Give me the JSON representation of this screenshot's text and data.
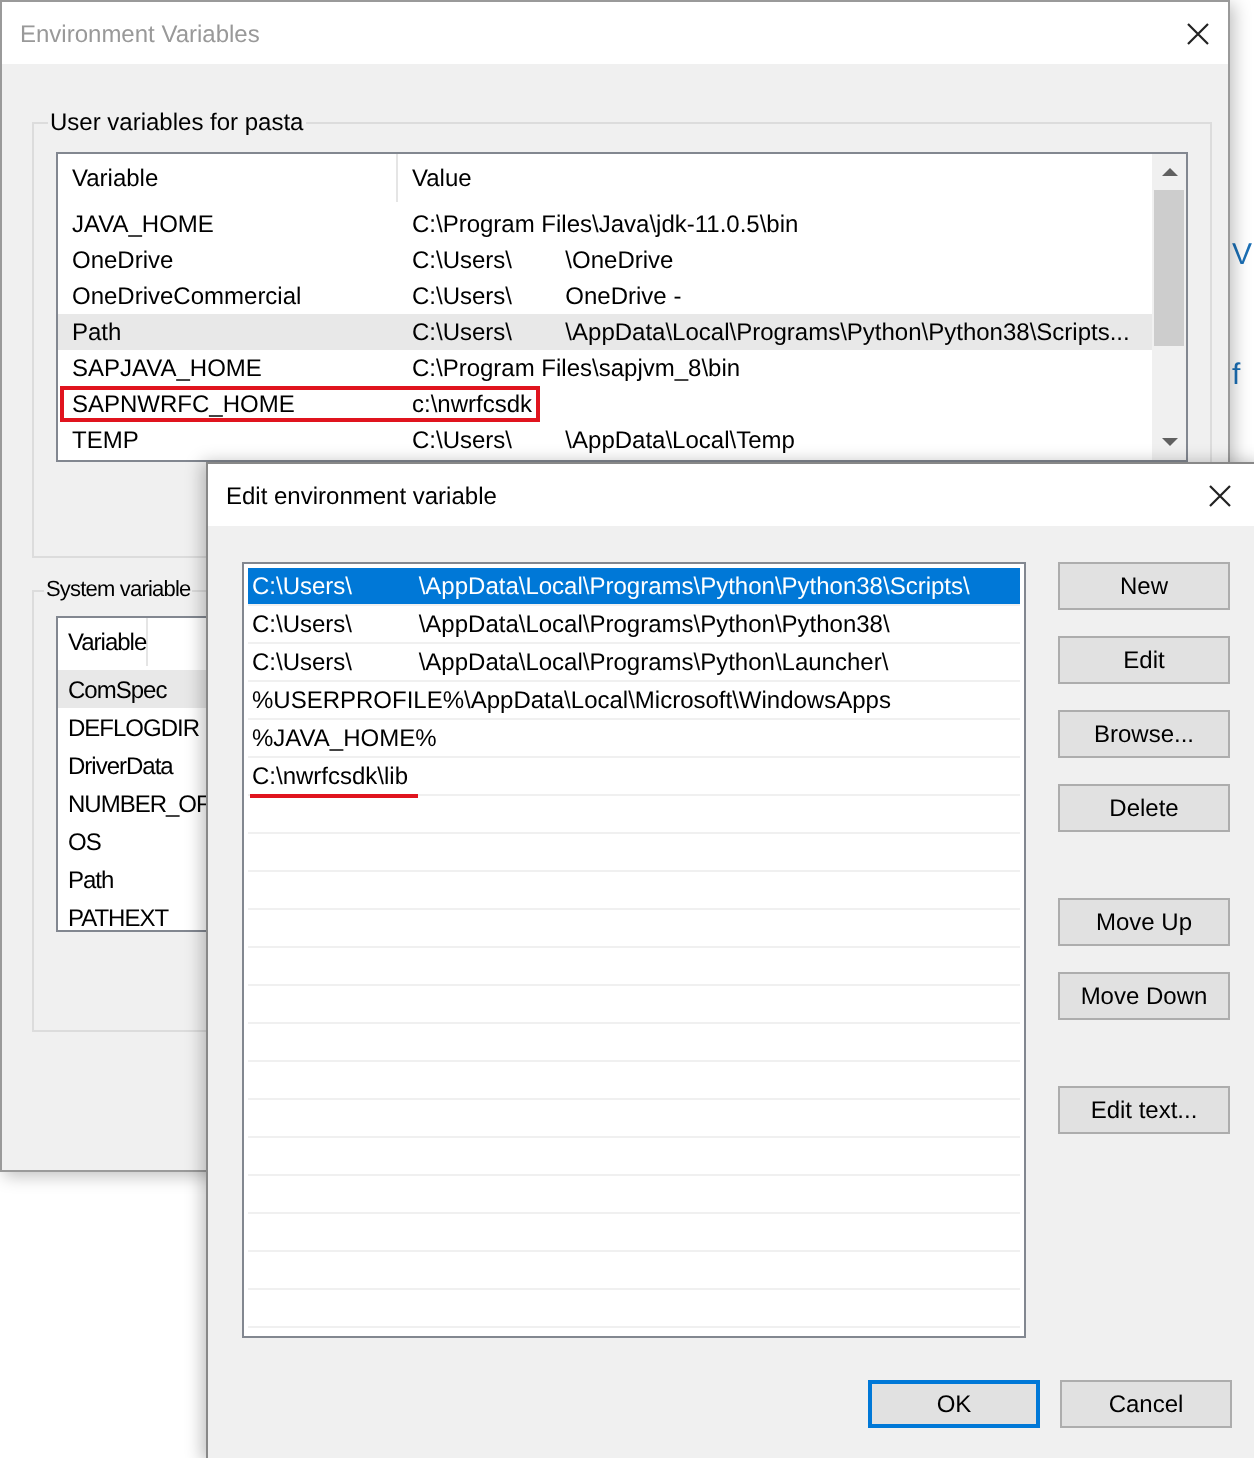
{
  "background_text": [
    "V",
    "f"
  ],
  "env_window": {
    "title": "Environment Variables",
    "user_group": {
      "label": "User variables for pasta",
      "columns": [
        "Variable",
        "Value"
      ],
      "rows": [
        {
          "variable": "JAVA_HOME",
          "value": "C:\\Program Files\\Java\\jdk-11.0.5\\bin",
          "hovered": false,
          "annotated": false
        },
        {
          "variable": "OneDrive",
          "value": "C:\\Users\\        \\OneDrive",
          "hovered": false,
          "annotated": false
        },
        {
          "variable": "OneDriveCommercial",
          "value": "C:\\Users\\        OneDrive -",
          "hovered": false,
          "annotated": false
        },
        {
          "variable": "Path",
          "value": "C:\\Users\\        \\AppData\\Local\\Programs\\Python\\Python38\\Scripts...",
          "hovered": true,
          "annotated": false
        },
        {
          "variable": "SAPJAVA_HOME",
          "value": "C:\\Program Files\\sapjvm_8\\bin",
          "hovered": false,
          "annotated": false
        },
        {
          "variable": "SAPNWRFC_HOME",
          "value": "c:\\nwrfcsdk",
          "hovered": false,
          "annotated": true
        },
        {
          "variable": "TEMP",
          "value": "C:\\Users\\        \\AppData\\Local\\Temp",
          "hovered": false,
          "annotated": false
        }
      ]
    },
    "system_group": {
      "label": "System variable",
      "columns": [
        "Variable"
      ],
      "rows": [
        {
          "variable": "ComSpec",
          "hovered": true
        },
        {
          "variable": "DEFLOGDIR",
          "hovered": false
        },
        {
          "variable": "DriverData",
          "hovered": false
        },
        {
          "variable": "NUMBER_OF",
          "hovered": false
        },
        {
          "variable": "OS",
          "hovered": false
        },
        {
          "variable": "Path",
          "hovered": false
        },
        {
          "variable": "PATHEXT",
          "hovered": false
        }
      ]
    }
  },
  "edit_dialog": {
    "title": "Edit environment variable",
    "items": [
      {
        "text": "C:\\Users\\          \\AppData\\Local\\Programs\\Python\\Python38\\Scripts\\",
        "selected": true,
        "annotated": false
      },
      {
        "text": "C:\\Users\\          \\AppData\\Local\\Programs\\Python\\Python38\\",
        "selected": false,
        "annotated": false
      },
      {
        "text": "C:\\Users\\          \\AppData\\Local\\Programs\\Python\\Launcher\\",
        "selected": false,
        "annotated": false
      },
      {
        "text": "%USERPROFILE%\\AppData\\Local\\Microsoft\\WindowsApps",
        "selected": false,
        "annotated": false
      },
      {
        "text": "%JAVA_HOME%",
        "selected": false,
        "annotated": false
      },
      {
        "text": "C:\\nwrfcsdk\\lib",
        "selected": false,
        "annotated": true
      }
    ],
    "button_groups": [
      [
        "New",
        "Edit",
        "Browse...",
        "Delete"
      ],
      [
        "Move Up",
        "Move Down"
      ],
      [
        "Edit text..."
      ]
    ],
    "footer_buttons": [
      {
        "label": "OK",
        "default": true
      },
      {
        "label": "Cancel",
        "default": false
      }
    ]
  }
}
